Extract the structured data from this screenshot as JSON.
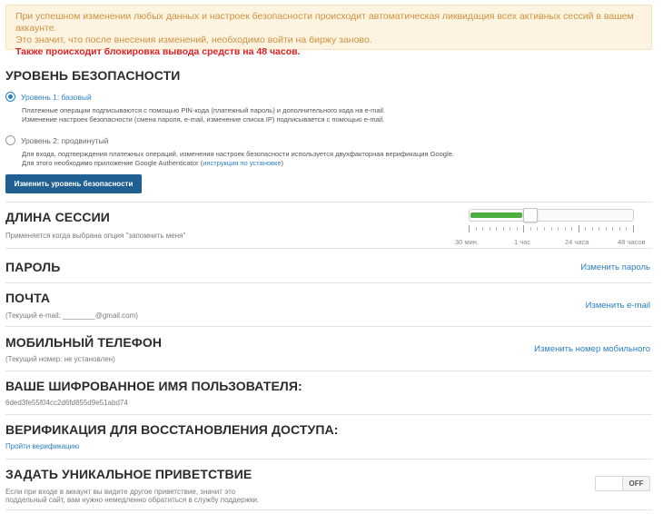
{
  "alert": {
    "line1": "При успешном изменении любых данных и настроек безопасности происходит автоматическая ликвидация всех активных сессий в вашем аккаунте.",
    "line2": "Это значит, что после внесения изменений, необходимо войти на биржу заново.",
    "warning": "Также происходит блокировка вывода средств на 48 часов."
  },
  "security": {
    "title": "УРОВЕНЬ БЕЗОПАСНОСТИ",
    "level1": {
      "label": "Уровень 1: базовый",
      "desc1": "Платежные операции подписываются с помощью PIN-кода (платежный пароль) и дополнительного кода на e-mail.",
      "desc2": "Изменение настроек безопасности (смена пароля, e-mail, изменение списка IP) подписывается с помощью e-mail.",
      "selected": true
    },
    "level2": {
      "label": "Уровень 2: продвинутый",
      "desc1": "Для входа, подтверждения платежных операций, изменения настроек безопасности используется двухфакторная верификация Google.",
      "desc2_prefix": "Для этого необходимо приложение Google Authenticator (",
      "desc2_link": "инструкция по установке",
      "desc2_suffix": ")",
      "selected": false
    },
    "button": "Изменить уровень безопасности"
  },
  "session": {
    "title": "ДЛИНА СЕССИИ",
    "subtitle": "Применяется когда выбрана опция \"запомнить меня\"",
    "ticks": [
      "30 мин.",
      "1 час",
      "24 часа",
      "48 часов"
    ],
    "value_fraction": 0.33
  },
  "password": {
    "title": "ПАРОЛЬ",
    "action": "Изменить пароль"
  },
  "email": {
    "title": "ПОЧТА",
    "current_prefix": "(Текущий e-mail: ",
    "current_value": "________@gmail.com",
    "current_suffix": ")",
    "action": "Изменить e-mail"
  },
  "phone": {
    "title": "МОБИЛЬНЫЙ ТЕЛЕФОН",
    "current": "(Текущий номер: не установлен)",
    "action": "Изменить номер мобильного"
  },
  "username": {
    "title": "ВАШЕ ШИФРОВАННОЕ ИМЯ ПОЛЬЗОВАТЕЛЯ:",
    "value": "6ded3fe55f04cc2d6fd855d9e51abd74"
  },
  "recovery": {
    "title": "ВЕРИФИКАЦИЯ ДЛЯ ВОССТАНОВЛЕНИЯ ДОСТУПА:",
    "action": "Пройти верификацию"
  },
  "greeting": {
    "title": "ЗАДАТЬ УНИКАЛЬНОЕ ПРИВЕТСТВИЕ",
    "desc1": "Если при входе в аккаунт вы видите другое приветствие, значит это",
    "desc2": "поддельный сайт, вам нужно немедленно обратиться в службу поддержки.",
    "toggle": "OFF"
  },
  "colors": {
    "accent": "#2a7fc4",
    "button": "#1f5f91",
    "slider_fill": "#4cae3f",
    "alert_bg": "#fcf3e1",
    "alert_text": "#d1923f",
    "danger": "#e02020"
  }
}
